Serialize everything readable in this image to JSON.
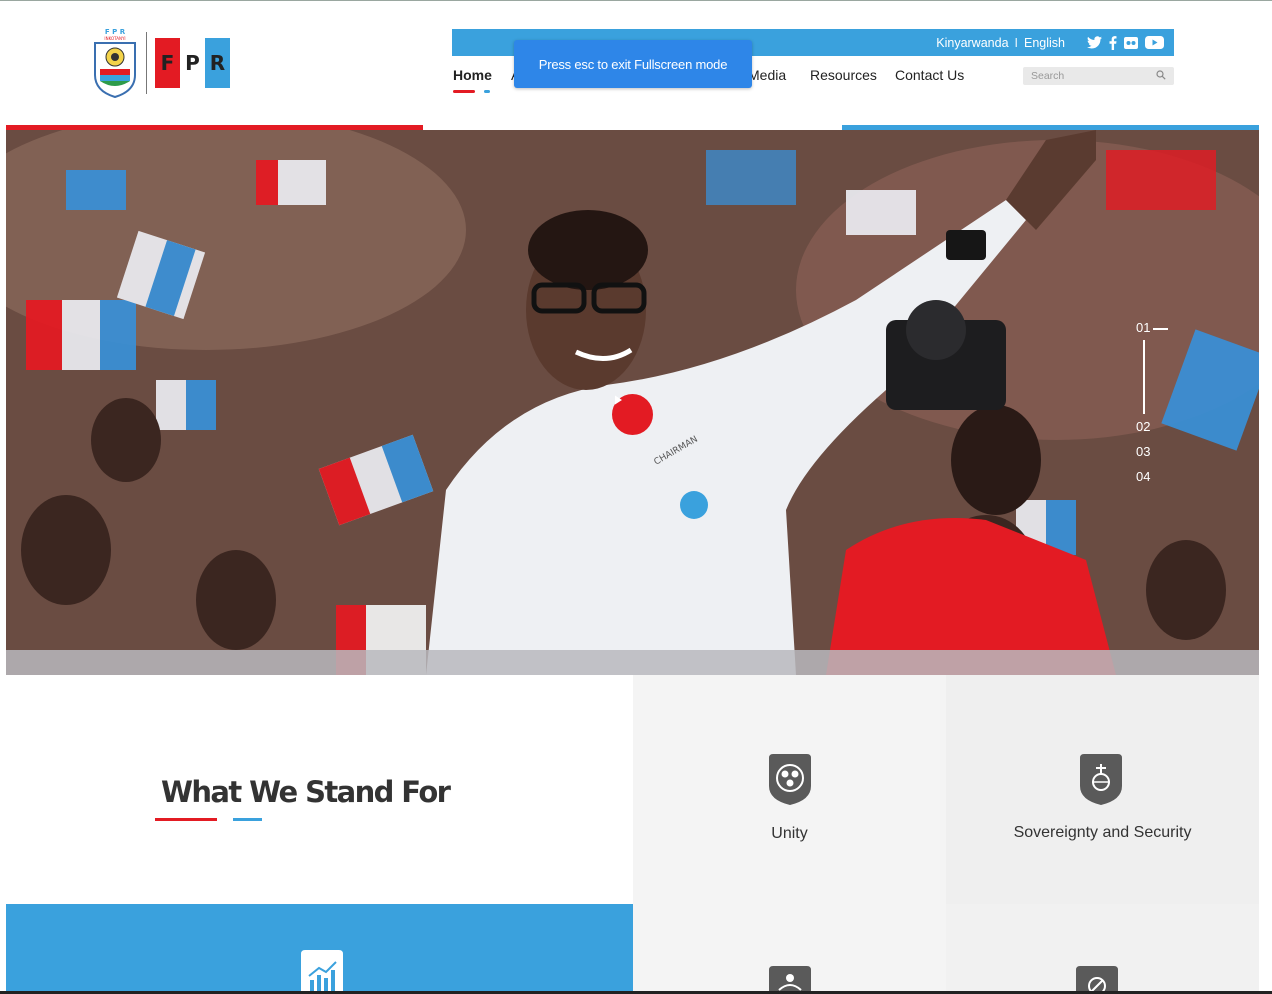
{
  "header": {
    "languages": [
      "Kinyarwanda",
      "English"
    ],
    "lang_separator": "I",
    "socials": [
      "twitter-icon",
      "facebook-icon",
      "flickr-icon",
      "youtube-icon"
    ],
    "logo_letters": [
      "F",
      "P",
      "R"
    ]
  },
  "nav": {
    "items": [
      {
        "label": "Home",
        "active": true
      },
      {
        "label": "A",
        "active": false
      },
      {
        "label": "Media",
        "active": false
      },
      {
        "label": "Resources",
        "active": false
      },
      {
        "label": "Contact Us",
        "active": false
      }
    ]
  },
  "search": {
    "placeholder": "Search"
  },
  "toast": {
    "text": "Press esc to exit Fullscreen mode"
  },
  "hero": {
    "slides": [
      "01",
      "02",
      "03",
      "04"
    ],
    "current_slide": "01",
    "shirt_text": "CHAIRMAN"
  },
  "stand_for": {
    "title": "What We Stand For",
    "items": [
      {
        "label": "Unity",
        "icon": "unity-icon"
      },
      {
        "label": "Sovereignty and Security",
        "icon": "sovereignty-icon"
      },
      {
        "label": "",
        "icon": "growth-chart-icon"
      },
      {
        "label": "",
        "icon": "people-icon"
      },
      {
        "label": "",
        "icon": "no-corruption-icon"
      }
    ]
  },
  "colors": {
    "red": "#e31b23",
    "blue": "#3aa1dd",
    "toast": "#2e86e8"
  }
}
